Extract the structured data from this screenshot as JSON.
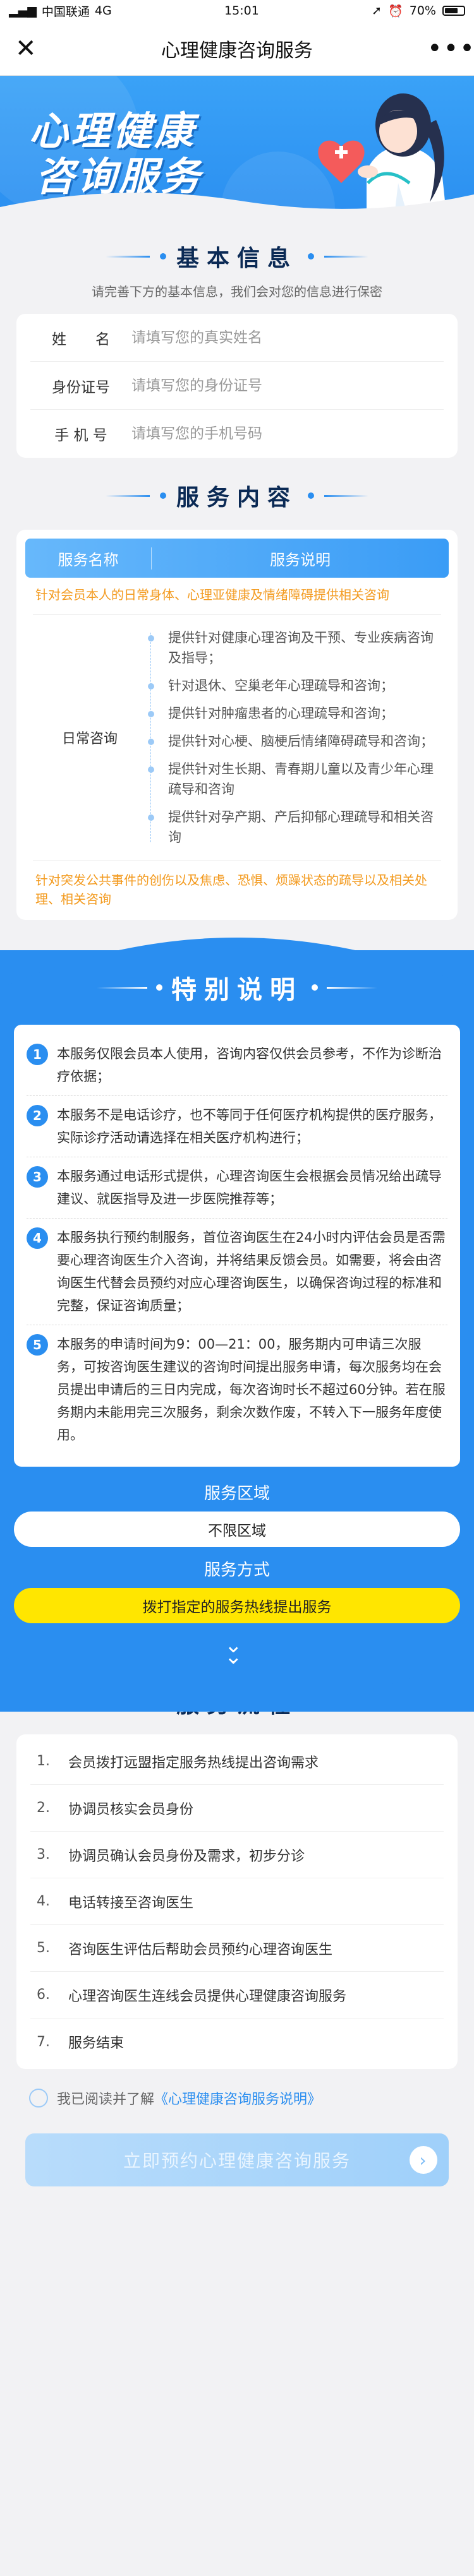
{
  "status": {
    "carrier": "中国联通",
    "network": "4G",
    "time": "15:01",
    "battery": "70%"
  },
  "nav": {
    "title": "心理健康咨询服务",
    "close_icon": "close-icon",
    "more_icon": "more-icon"
  },
  "banner": {
    "line1": "心理健康",
    "line2": "咨询服务"
  },
  "basic": {
    "title": "基本信息",
    "subtitle": "请完善下方的基本信息，我们会对您的信息进行保密",
    "fields": [
      {
        "label": "姓　　名",
        "placeholder": "请填写您的真实姓名"
      },
      {
        "label": "身份证号",
        "placeholder": "请填写您的身份证号"
      },
      {
        "label": "手 机 号",
        "placeholder": "请填写您的手机号码"
      }
    ]
  },
  "services": {
    "title": "服务内容",
    "col1": "服务名称",
    "col2": "服务说明",
    "note_top": "针对会员本人的日常身体、心理亚健康及情绪障碍提供相关咨询",
    "category": "日常咨询",
    "items": [
      "提供针对健康心理咨询及干预、专业疾病咨询及指导；",
      "针对退休、空巢老年心理疏导和咨询；",
      "提供针对肿瘤患者的心理疏导和咨询；",
      "提供针对心梗、脑梗后情绪障碍疏导和咨询；",
      "提供针对生长期、青春期儿童以及青少年心理疏导和咨询",
      "提供针对孕产期、产后抑郁心理疏导和相关咨询"
    ],
    "note_bottom": "针对突发公共事件的创伤以及焦虑、恐惧、烦躁状态的疏导以及相关处理、相关咨询"
  },
  "special": {
    "title": "特别说明",
    "notes": [
      {
        "n": "1",
        "text": "本服务仅限会员本人使用，咨询内容仅供会员参考，不作为诊断治疗依据；"
      },
      {
        "n": "2",
        "text": "本服务不是电话诊疗，也不等同于任何医疗机构提供的医疗服务，实际诊疗活动请选择在相关医疗机构进行；"
      },
      {
        "n": "3",
        "text": "本服务通过电话形式提供，心理咨询医生会根据会员情况给出疏导建议、就医指导及进一步医院推荐等；"
      },
      {
        "n": "4",
        "text": "本服务执行预约制服务，首位咨询医生在24小时内评估会员是否需要心理咨询医生介入咨询，并将结果反馈会员。如需要，将会由咨询医生代替会员预约对应心理咨询医生，以确保咨询过程的标准和完整，保证咨询质量；"
      },
      {
        "n": "5",
        "text": "本服务的申请时间为9：00—21：00，服务期内可申请三次服务，可按咨询医生建议的咨询时间提出服务申请，每次服务均在会员提出申请后的三日内完成，每次咨询时长不超过60分钟。若在服务期内未能用完三次服务，剩余次数作废，不转入下一服务年度使用。"
      }
    ],
    "area_label": "服务区域",
    "area_value": "不限区域",
    "method_label": "服务方式",
    "method_value": "拨打指定的服务热线提出服务",
    "chevron_icon": "chevron-down-icon"
  },
  "process": {
    "title": "服务流程",
    "steps": [
      {
        "n": "1.",
        "text": "会员拨打远盟指定服务热线提出咨询需求"
      },
      {
        "n": "2.",
        "text": "协调员核实会员身份"
      },
      {
        "n": "3.",
        "text": "协调员确认会员身份及需求，初步分诊"
      },
      {
        "n": "4.",
        "text": "电话转接至咨询医生"
      },
      {
        "n": "5.",
        "text": "咨询医生评估后帮助会员预约心理咨询医生"
      },
      {
        "n": "6.",
        "text": "心理咨询医生连线会员提供心理健康咨询服务"
      },
      {
        "n": "7.",
        "text": "服务结束"
      }
    ]
  },
  "agreement": {
    "prefix": "我已阅读并了解",
    "link": "《心理健康咨询服务说明》"
  },
  "submit": {
    "label": "立即预约心理健康咨询服务",
    "icon": "arrow-right-icon"
  },
  "colors": {
    "primary": "#2a8ef0",
    "accent": "#ffe600",
    "warning": "#f39a1e"
  }
}
